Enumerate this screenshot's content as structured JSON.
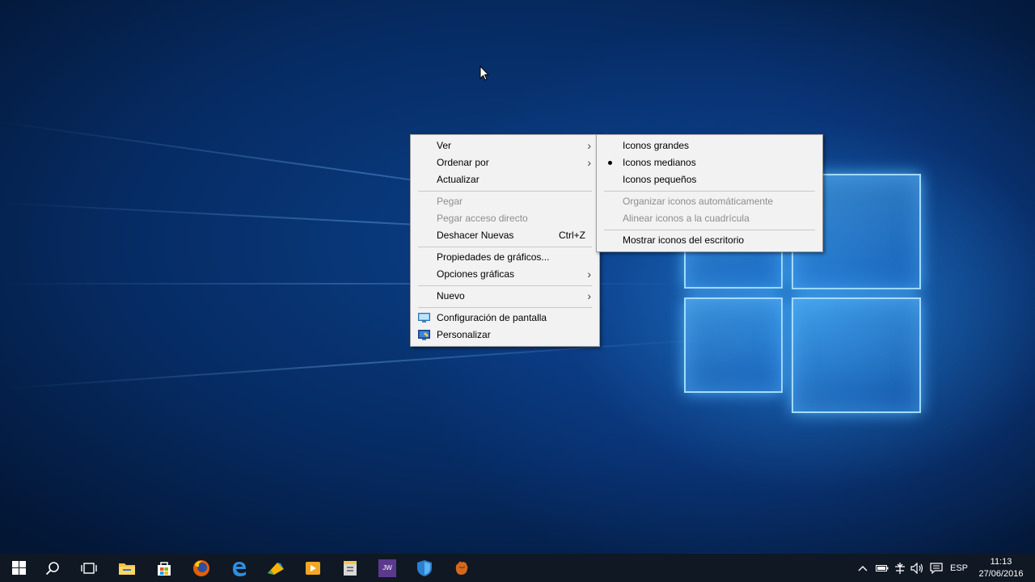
{
  "context_menu": {
    "items": [
      {
        "label": "Ver"
      },
      {
        "label": "Ordenar por"
      },
      {
        "label": "Actualizar"
      },
      {
        "label": "Pegar"
      },
      {
        "label": "Pegar acceso directo"
      },
      {
        "label": "Deshacer Nuevas",
        "shortcut": "Ctrl+Z"
      },
      {
        "label": "Propiedades de gráficos..."
      },
      {
        "label": "Opciones gráficas"
      },
      {
        "label": "Nuevo"
      },
      {
        "label": "Configuración de pantalla"
      },
      {
        "label": "Personalizar"
      }
    ]
  },
  "view_submenu": {
    "items": [
      {
        "label": "Iconos grandes"
      },
      {
        "label": "Iconos medianos"
      },
      {
        "label": "Iconos pequeños"
      },
      {
        "label": "Organizar iconos automáticamente"
      },
      {
        "label": "Alinear iconos a la cuadrícula"
      },
      {
        "label": "Mostrar iconos del escritorio"
      }
    ]
  },
  "taskbar": {
    "pinned_icons": [
      "windows-start-icon",
      "search-icon",
      "task-view-icon",
      "file-explorer-icon",
      "store-icon",
      "firefox-icon",
      "edge-icon",
      "drawing-app-icon",
      "media-player-icon",
      "archive-icon",
      "jw-app-icon",
      "shield-app-icon",
      "baseball-glove-icon"
    ],
    "jw_label": "JW",
    "language": "ESP",
    "time": "11:13",
    "date": "27/06/2016"
  },
  "colors": {
    "menu_background": "#f2f2f2",
    "disabled_text": "#8d8d8d",
    "taskbar": "#101824"
  }
}
